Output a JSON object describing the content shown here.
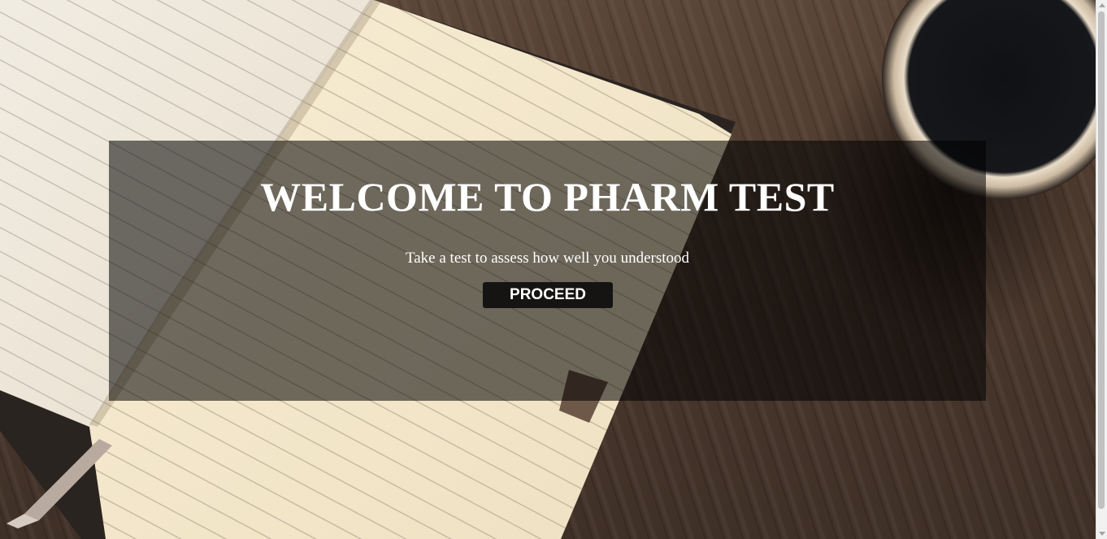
{
  "hero": {
    "title": "WELCOME TO PHARM TEST",
    "subtitle": "Take a test to assess how well you understood",
    "button_label": "PROCEED"
  },
  "background": {
    "scene": "notebook-and-coffee-cup-on-wooden-table"
  },
  "colors": {
    "overlay": "#000000",
    "button": "#161412",
    "text": "#ffffff"
  }
}
